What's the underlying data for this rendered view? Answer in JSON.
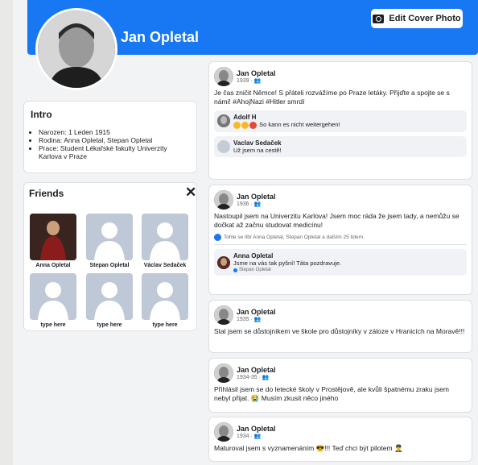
{
  "header": {
    "name": "Jan Opletal",
    "edit_cover_label": "Edit Cover Photo"
  },
  "intro": {
    "title": "Intro",
    "items": [
      "Narozen: 1 Leden 1915",
      "Rodina: Anna Opletal, Stepan Opletal",
      "Prace: Student Lékařské fakulty Univerzity Karlova v Praze"
    ]
  },
  "friends": {
    "title": "Friends",
    "close_symbol": "✕",
    "items": [
      {
        "name": "Anna Opletal"
      },
      {
        "name": "Stepan Opletal"
      },
      {
        "name": "Václav Sedaček"
      },
      {
        "name": "type here"
      },
      {
        "name": "type here"
      },
      {
        "name": "type here"
      }
    ]
  },
  "posts": [
    {
      "author": "Jan Opletal",
      "date": "1939 · 👥",
      "text": "Je čas zničit Němce! S přáteli rozvážíme po Praze letáky. Přijďte a spojte se s námi! #AhojNazi #Hitler smrdí",
      "comments": [
        {
          "author": "Adolf H",
          "text": "So kann es nicht weitergehen!"
        },
        {
          "author": "Vaclav Sedaček",
          "text": "Už jsem na cestě!"
        }
      ]
    },
    {
      "author": "Jan Opletal",
      "date": "1936 · 👥",
      "text": "Nastoupil jsem na Univerzitu Karlova! Jsem moc ráda že jsem tady, a nemůžu se dočkat až začnu studovat medicínu!",
      "likes": "Tohle se líbí Anna Opletal, Stepan Opletal a dalším 25 lidem.",
      "comments": [
        {
          "author": "Anna Opletal",
          "text": "Jsme na vás tak pyšní! Táta pozdravuje.",
          "sub": "Stepan Opletal"
        }
      ]
    },
    {
      "author": "Jan Opletal",
      "date": "1935 · 👥",
      "text": "Stal jsem se důstojníkem ve škole pro důstojníky v záloze v Hranicích na Moravě!!!"
    },
    {
      "author": "Jan Opletal",
      "date": "1934-35 · 👥",
      "text": "Přihlásil jsem se do letecké školy v Prostějově, ale kvůli špatnému zraku jsem nebyl přijat. 😭 Musím zkusit něco jiného"
    },
    {
      "author": "Jan Opletal",
      "date": "1934 · 👥",
      "text": "Maturoval jsem s vyznamenáním 😎!!! Teď chci být pilotem 👨‍✈️"
    }
  ]
}
